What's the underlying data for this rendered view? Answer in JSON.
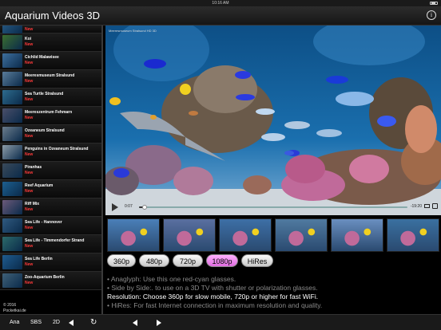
{
  "status": {
    "time": "10:16 AM"
  },
  "nav": {
    "title": "Aquarium Videos 3D"
  },
  "sidebar": {
    "items": [
      {
        "name": "",
        "badge": "New",
        "color": "#2a5f8a"
      },
      {
        "name": "Koi",
        "badge": "New",
        "color": "#3b6e2f"
      },
      {
        "name": "Cichlid Malawisee",
        "badge": "New",
        "color": "#3e6f9e"
      },
      {
        "name": "Meeresmuseum Stralsund",
        "badge": "New",
        "color": "#5a7c9a"
      },
      {
        "name": "Sea Turtle Stralsund",
        "badge": "New",
        "color": "#2e6c8e"
      },
      {
        "name": "Meereszentrum Fehmarn",
        "badge": "New",
        "color": "#4a4f6a"
      },
      {
        "name": "Ozeaneum Stralsund",
        "badge": "New",
        "color": "#6b7c8c"
      },
      {
        "name": "Penguins in Ozeaneum Stralsund",
        "badge": "New",
        "color": "#8c9ca8"
      },
      {
        "name": "Piranhas",
        "badge": "New",
        "color": "#3a4a5a"
      },
      {
        "name": "Reef Aquarium",
        "badge": "New",
        "color": "#1d5f8f"
      },
      {
        "name": "Riff Mix",
        "badge": "New",
        "color": "#6c5a7a"
      },
      {
        "name": "Sea Life - Hannover",
        "badge": "New",
        "color": "#305a80"
      },
      {
        "name": "Sea Life - Timmendorfer Strand",
        "badge": "New",
        "color": "#2c6a6a"
      },
      {
        "name": "Sea Life Berlin",
        "badge": "New",
        "color": "#1f5c8f"
      },
      {
        "name": "Zoo-Aquarium Berlin",
        "badge": "New",
        "color": "#3f6077"
      }
    ],
    "copyright": "© 2016",
    "copyright2": "Pocketkai.de"
  },
  "video": {
    "title": "Meeresmuseum Stralsund HD 3D",
    "current_time": "0:07",
    "remaining_time": "-19:20",
    "progress": 0.02
  },
  "thumbnails": [
    "#4a7fb8",
    "#5a6fa0",
    "#3d6fa6",
    "#507aa0",
    "#6a8fc0",
    "#3a70a0"
  ],
  "resolutions": {
    "buttons": [
      "360p",
      "480p",
      "720p",
      "1080p",
      "HiRes"
    ],
    "active": "1080p",
    "active_color": "#f08cf0"
  },
  "info": {
    "line1": "• Anaglyph: Use this one red-cyan glasses.",
    "line2": "• Side by Side:. to use on a 3D TV with shutter or polarization glasses.",
    "line3": "Resolution: Choose 360p for slow mobile, 720p or higher for fast WiFi.",
    "line4": "• HiRes: For fast Internet connection in maximum resolution and quality."
  },
  "toolbar": {
    "ana": "Ana",
    "sbs": "SBS",
    "twod": "2D"
  }
}
